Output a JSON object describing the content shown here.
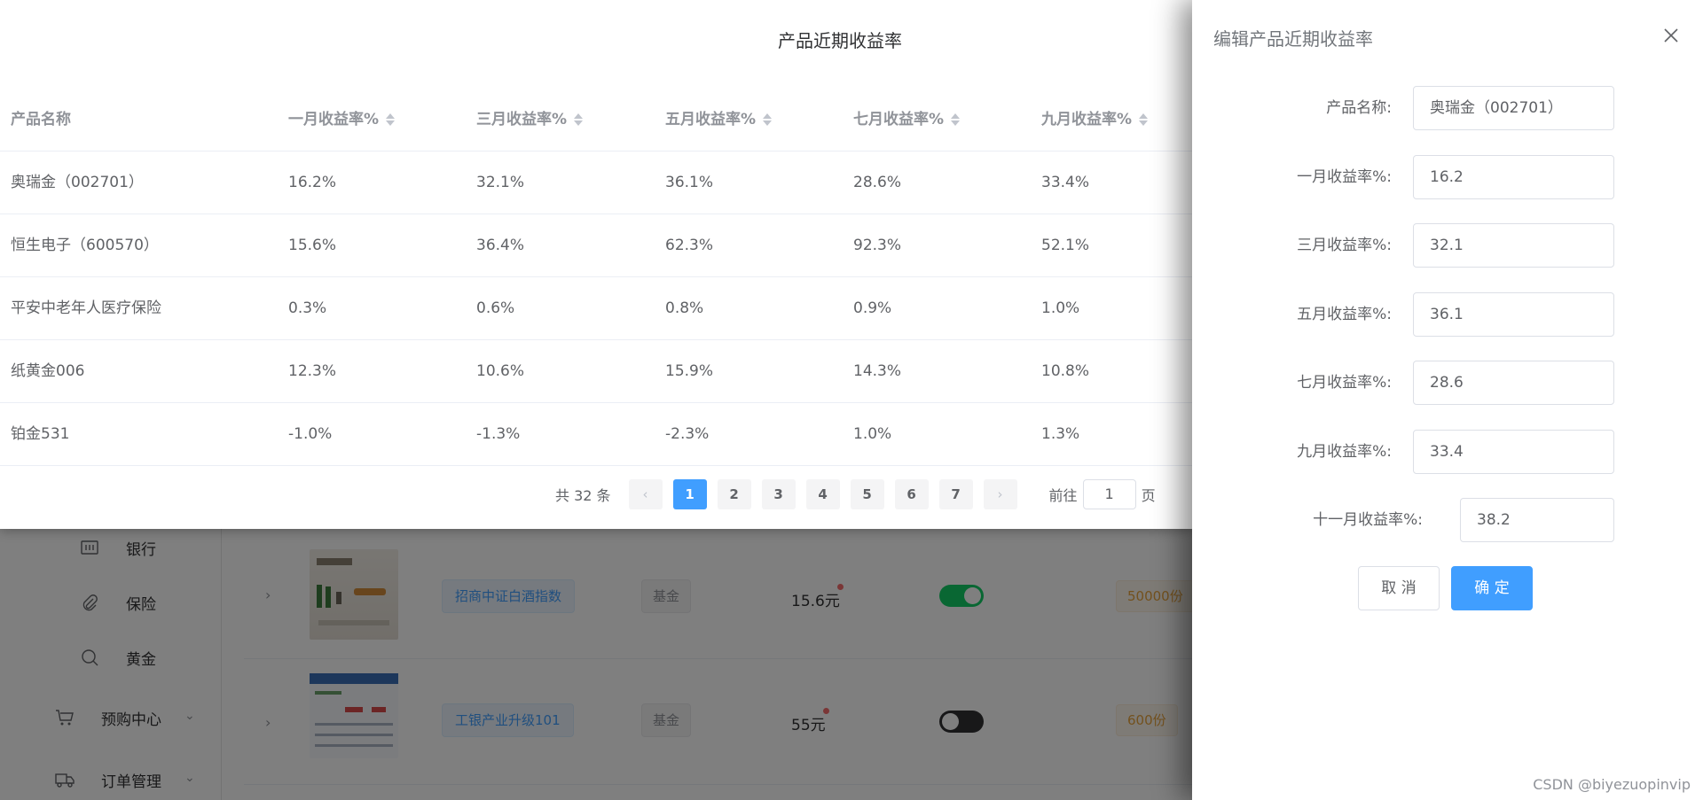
{
  "sidebar": {
    "items": [
      {
        "label": "银行",
        "icon": "bank-icon"
      },
      {
        "label": "保险",
        "icon": "paperclip-icon"
      },
      {
        "label": "黄金",
        "icon": "search-icon"
      },
      {
        "label": "预购中心",
        "icon": "cart-icon"
      },
      {
        "label": "订单管理",
        "icon": "truck-icon"
      }
    ]
  },
  "product_list": {
    "rows": [
      {
        "name": "招商中证白酒指数",
        "type": "基金",
        "price": "15.6元",
        "enabled": true,
        "stock": "50000份"
      },
      {
        "name": "工银产业升级101",
        "type": "基金",
        "price": "55元",
        "enabled": false,
        "stock": "600份"
      }
    ]
  },
  "table_dialog": {
    "title": "产品近期收益率",
    "headers": [
      "产品名称",
      "一月收益率%",
      "三月收益率%",
      "五月收益率%",
      "七月收益率%",
      "九月收益率%"
    ],
    "rows": [
      [
        "奥瑞金（002701）",
        "16.2%",
        "32.1%",
        "36.1%",
        "28.6%",
        "33.4%"
      ],
      [
        "恒生电子（600570）",
        "15.6%",
        "36.4%",
        "62.3%",
        "92.3%",
        "52.1%"
      ],
      [
        "平安中老年人医疗保险",
        "0.3%",
        "0.6%",
        "0.8%",
        "0.9%",
        "1.0%"
      ],
      [
        "纸黄金006",
        "12.3%",
        "10.6%",
        "15.9%",
        "14.3%",
        "10.8%"
      ],
      [
        "铂金531",
        "-1.0%",
        "-1.3%",
        "-2.3%",
        "1.0%",
        "1.3%"
      ]
    ],
    "pagination": {
      "total": "共 32 条",
      "pages": [
        "1",
        "2",
        "3",
        "4",
        "5",
        "6",
        "7"
      ],
      "current": "1",
      "goto_prefix": "前往",
      "goto_value": "1",
      "goto_suffix": "页"
    }
  },
  "drawer": {
    "title": "编辑产品近期收益率",
    "fields": [
      {
        "label": "产品名称:",
        "value": "奥瑞金（002701）"
      },
      {
        "label": "一月收益率%:",
        "value": "16.2"
      },
      {
        "label": "三月收益率%:",
        "value": "32.1"
      },
      {
        "label": "五月收益率%:",
        "value": "36.1"
      },
      {
        "label": "七月收益率%:",
        "value": "28.6"
      },
      {
        "label": "九月收益率%:",
        "value": "33.4"
      },
      {
        "label": "十一月收益率%:",
        "value": "38.2"
      }
    ],
    "cancel_label": "取 消",
    "confirm_label": "确 定"
  },
  "watermark": "CSDN @biyezuopinvip",
  "colors": {
    "primary": "#409eff",
    "switch_on": "#13ce66",
    "switch_off": "#303133",
    "mask": "rgba(0,0,0,0.5)"
  }
}
